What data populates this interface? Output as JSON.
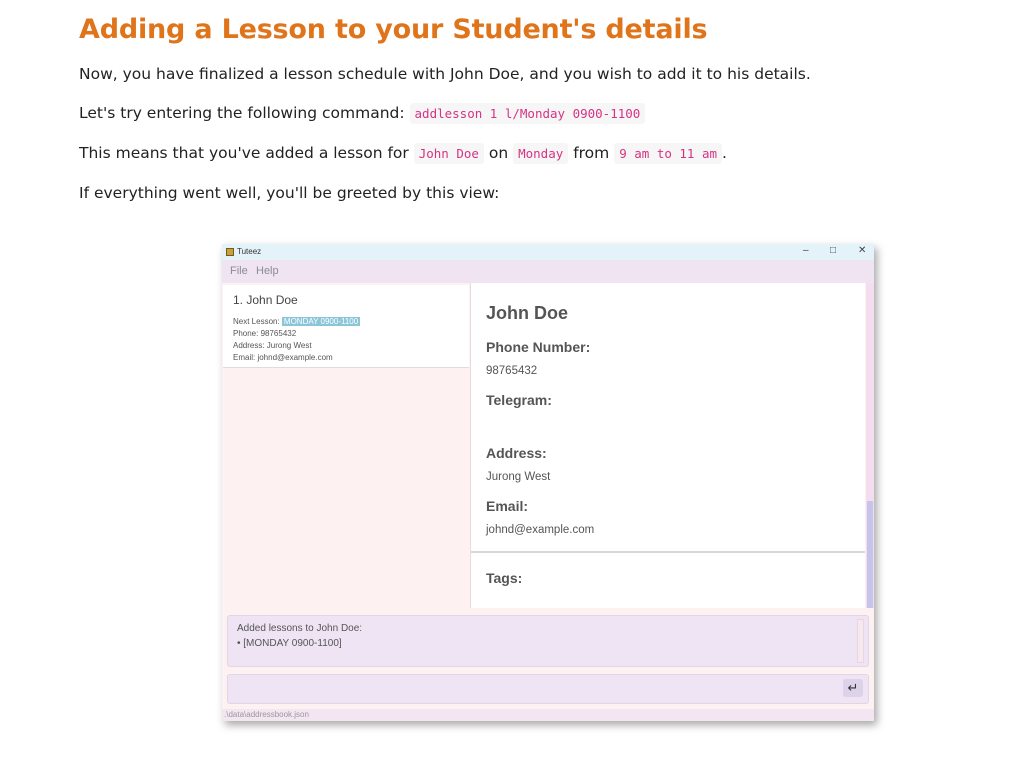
{
  "doc": {
    "heading": "Adding a Lesson to your Student's details",
    "p1": "Now, you have finalized a lesson schedule with John Doe, and you wish to add it to his details.",
    "p2_prefix": "Let's try entering the following command: ",
    "p2_code": "addlesson 1 l/Monday 0900-1100",
    "p3_a": "This means that you've added a lesson for ",
    "p3_code1": "John Doe",
    "p3_b": " on ",
    "p3_code2": "Monday",
    "p3_c": " from ",
    "p3_code3": "9 am to 11 am",
    "p3_d": ".",
    "p4": "If everything went well, you'll be greeted by this view:"
  },
  "app": {
    "title": "Tuteez",
    "window_buttons": {
      "minimize": "–",
      "maximize": "□",
      "close": "✕"
    },
    "menu": [
      "File",
      "Help"
    ],
    "list": [
      {
        "name": "1. John Doe",
        "next_lesson_label": "Next Lesson: ",
        "next_lesson_value": "MONDAY 0900-1100",
        "phone": "Phone: 98765432",
        "address": "Address: Jurong West",
        "email": "Email: johnd@example.com"
      }
    ],
    "detail": {
      "name": "John Doe",
      "phone_label": "Phone Number:",
      "phone_value": "98765432",
      "telegram_label": "Telegram:",
      "telegram_value": "",
      "address_label": "Address:",
      "address_value": "Jurong West",
      "email_label": "Email:",
      "email_value": "johnd@example.com",
      "tags_label": "Tags:"
    },
    "result": {
      "line1": "Added lessons to John Doe:",
      "line2": "• [MONDAY 0900-1100]"
    },
    "command": {
      "value": "",
      "enter_icon": "enter-icon",
      "enter_glyph": "↵"
    },
    "status": ".\\data\\addressbook.json",
    "colors": {
      "heading": "#e0741b",
      "code_text": "#d63384",
      "highlight": "#8ac6d8",
      "titlebar": "#e4f3f9",
      "panel": "#efe4f3"
    }
  }
}
